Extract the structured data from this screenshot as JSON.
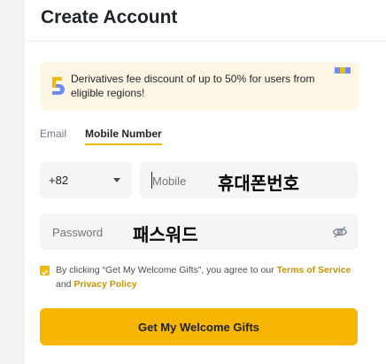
{
  "page": {
    "title": "Create Account"
  },
  "promo": {
    "badge_icon": "five-percent-badge-icon",
    "text": "Derivatives fee discount of up to 50% for users from eligible regions!"
  },
  "tabs": [
    {
      "label": "Email",
      "active": false
    },
    {
      "label": "Mobile Number",
      "active": true
    }
  ],
  "mobile": {
    "country_code": "+82",
    "placeholder": "Mobile",
    "annotation": "휴대폰번호"
  },
  "password": {
    "placeholder": "Password",
    "annotation": "패스워드",
    "visibility_icon": "eye-off-icon"
  },
  "terms": {
    "checked": true,
    "prefix": "By clicking “Get My Welcome Gifts”, you agree to our ",
    "tos_link": "Terms of Service",
    "middle": "and ",
    "privacy_link": "Privacy Policy"
  },
  "cta": {
    "label": "Get My Welcome Gifts"
  },
  "colors": {
    "accent": "#f0b90b",
    "button": "#f8b502",
    "promo_bg": "#fef6e4",
    "field_bg": "#f5f5f5",
    "link": "#c99400"
  }
}
